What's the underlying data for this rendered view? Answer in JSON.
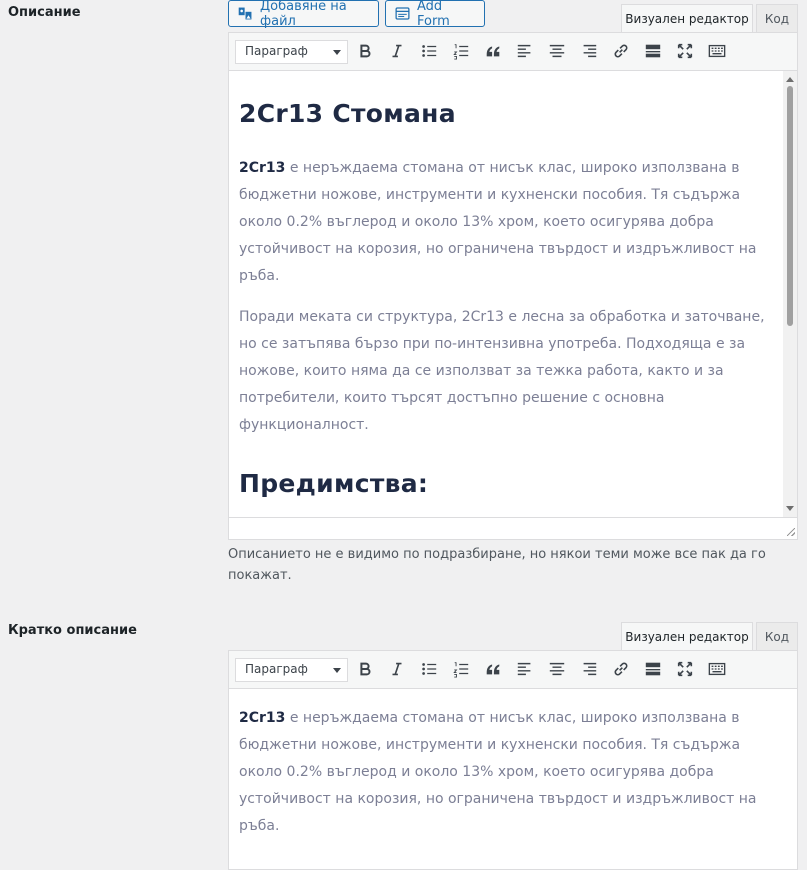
{
  "description": {
    "label": "Описание",
    "buttons": {
      "add_file": "Добавяне на файл",
      "add_form": "Add Form"
    },
    "tabs": {
      "visual": "Визуален редактор",
      "code": "Код"
    },
    "toolbar": {
      "format": "Параграф"
    },
    "content": {
      "heading1": "2Cr13 Стомана",
      "p1_bold": "2Cr13",
      "p1_rest": " е неръждаема стомана от нисък клас, широко използвана в бюджетни ножове, инструменти и кухненски пособия. Тя съдържа около 0.2% въглерод и около 13% хром, което осигурява добра устойчивост на корозия, но ограничена твърдост и издръжливост на ръба.",
      "p2": "Поради меката си структура, 2Cr13 е лесна за обработка и заточване, но се затъпява бързо при по-интензивна употреба. Подходяща е за ножове, които няма да се използват за тежка работа, както и за потребители, които търсят достъпно решение с основна функционалност.",
      "heading2": "Предимства:"
    },
    "help": "Описанието не е видимо по подразбиране, но някои теми може все пак да го покажат."
  },
  "short_description": {
    "label": "Кратко описание",
    "tabs": {
      "visual": "Визуален редактор",
      "code": "Код"
    },
    "toolbar": {
      "format": "Параграф"
    },
    "content": {
      "p1_bold": "2Cr13",
      "p1_rest": " е неръждаема стомана от нисък клас, широко използвана в бюджетни ножове, инструменти и кухненски пособия. Тя съдържа около 0.2% въглерод и около 13% хром, което осигурява добра устойчивост на корозия, но ограничена твърдост и издръжливост на ръба."
    }
  },
  "icons": [
    "add-media-icon",
    "add-form-icon",
    "bold-icon",
    "italic-icon",
    "bullet-list-icon",
    "numbered-list-icon",
    "blockquote-icon",
    "align-left-icon",
    "align-center-icon",
    "align-right-icon",
    "link-icon",
    "read-more-icon",
    "fullscreen-icon",
    "toolbar-toggle-icon"
  ],
  "colors": {
    "accent": "#2271b1",
    "heading": "#1f2a44",
    "body_text": "#7c7f95"
  }
}
